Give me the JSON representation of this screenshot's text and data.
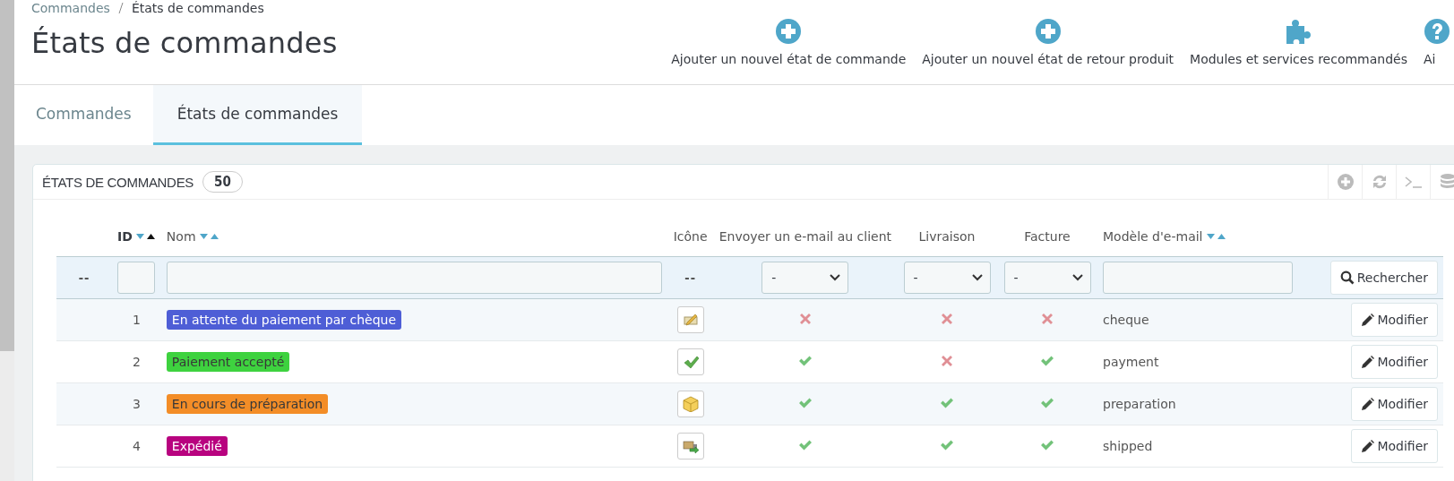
{
  "breadcrumb": [
    {
      "label": "Commandes",
      "current": false
    },
    {
      "label": "États de commandes",
      "current": true
    }
  ],
  "page_title": "États de commandes",
  "toolbar": [
    {
      "label": "Ajouter un nouvel état de commande",
      "kind": "add"
    },
    {
      "label": "Ajouter un nouvel état de retour produit",
      "kind": "add"
    },
    {
      "label": "Modules et services recommandés",
      "kind": "modules"
    },
    {
      "label": "Ai",
      "kind": "help"
    }
  ],
  "tabs": [
    {
      "label": "Commandes",
      "selected": false
    },
    {
      "label": "États de commandes",
      "selected": true
    }
  ],
  "panel": {
    "title": "ÉTATS DE COMMANDES",
    "count": "50"
  },
  "table": {
    "columns": [
      {},
      {
        "label": "ID",
        "sortable": true,
        "sorted_asc": true
      },
      {
        "label": "Nom",
        "sortable": true,
        "sorted_asc": false
      },
      {
        "label": "Icône"
      },
      {
        "label": "Envoyer un e-mail au client"
      },
      {
        "label": "Livraison"
      },
      {
        "label": "Facture"
      },
      {
        "label": "Modèle d'e-mail",
        "sortable": true,
        "sorted_asc": false
      },
      {}
    ],
    "filters": [
      {
        "kind": "text",
        "value": "--"
      },
      {
        "kind": "input"
      },
      {
        "kind": "input"
      },
      {
        "kind": "text",
        "value": "--"
      },
      {
        "kind": "select",
        "value": "-"
      },
      {
        "kind": "select",
        "value": "-"
      },
      {
        "kind": "select",
        "value": "-"
      },
      {
        "kind": "input"
      },
      {
        "kind": "button",
        "label": "Rechercher"
      }
    ],
    "rows": [
      {
        "id": "1",
        "name": "En attente du paiement par chèque",
        "color": "#4e5ed6",
        "kind": "cheque",
        "send_email": false,
        "delivery": false,
        "invoice": false,
        "template": "cheque",
        "action": "Modifier"
      },
      {
        "id": "2",
        "name": "Paiement accepté",
        "color": "#3ed23f",
        "kind": "check",
        "send_email": true,
        "delivery": false,
        "invoice": true,
        "template": "payment",
        "action": "Modifier"
      },
      {
        "id": "3",
        "name": "En cours de préparation",
        "color": "#f38d27",
        "kind": "box",
        "send_email": true,
        "delivery": true,
        "invoice": true,
        "template": "preparation",
        "action": "Modifier"
      },
      {
        "id": "4",
        "name": "Expédié",
        "color": "#b8037f",
        "kind": "truck",
        "send_email": true,
        "delivery": true,
        "invoice": true,
        "template": "shipped",
        "action": "Modifier"
      }
    ]
  }
}
